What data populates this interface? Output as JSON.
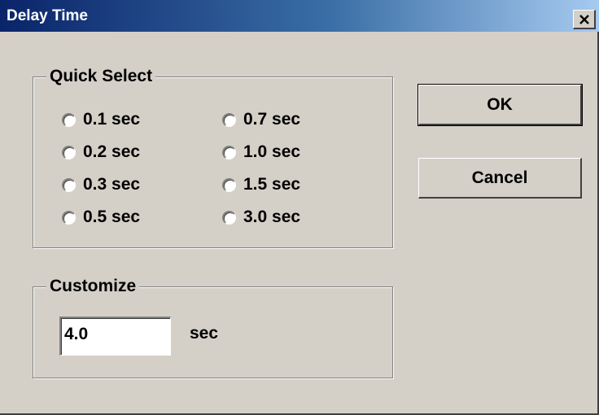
{
  "window": {
    "title": "Delay Time",
    "close_icon": "close-icon"
  },
  "quick_select": {
    "legend": "Quick Select",
    "options": [
      {
        "label": "0.1 sec",
        "selected": false
      },
      {
        "label": "0.2 sec",
        "selected": false
      },
      {
        "label": "0.3 sec",
        "selected": false
      },
      {
        "label": "0.5 sec",
        "selected": false
      },
      {
        "label": "0.7 sec",
        "selected": false
      },
      {
        "label": "1.0 sec",
        "selected": false
      },
      {
        "label": "1.5 sec",
        "selected": false
      },
      {
        "label": "3.0 sec",
        "selected": false
      }
    ]
  },
  "customize": {
    "legend": "Customize",
    "value": "4.0",
    "unit": "sec"
  },
  "buttons": {
    "ok_label": "OK",
    "cancel_label": "Cancel"
  },
  "colors": {
    "dialog_face": "#d4d0c8",
    "title_start": "#0a246a",
    "title_end": "#a6caf0"
  }
}
